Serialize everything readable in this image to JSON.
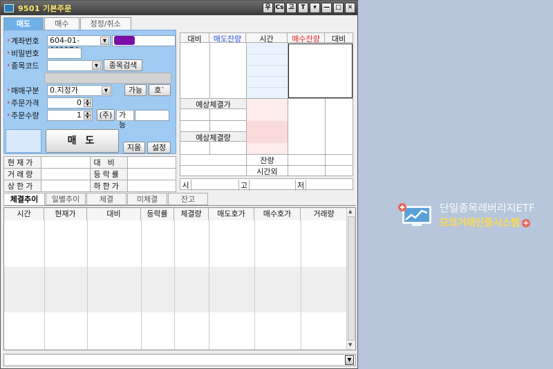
{
  "window": {
    "title": "9501 기본주문",
    "title_buttons": [
      "우",
      "Cs",
      "고",
      "T",
      "▾",
      "—",
      "□",
      "✕"
    ]
  },
  "order_tabs": [
    "매도",
    "매수",
    "정정/취소"
  ],
  "form": {
    "account_label": "계좌번호",
    "account_value": "604-01-001174",
    "password_label": "비밀번호",
    "code_label": "종목코드",
    "search_button": "종목검색",
    "type_label": "매매구분",
    "type_value": "0.지정가",
    "avail_button": "가능",
    "quote_button": "호`",
    "price_label": "주문가격",
    "price_value": "0",
    "qty_label": "주문수량",
    "qty_value": "1",
    "unit_button": "(주)",
    "qty_avail_label": "가능",
    "sell_button": "매 도",
    "clear_button": "지움",
    "settings_button": "설정"
  },
  "info_table": {
    "current_price": "현재가",
    "change": "대비",
    "volume": "거래량",
    "change_rate": "등락률",
    "upper_limit": "상한가",
    "lower_limit": "하한가"
  },
  "hoga": {
    "headers": [
      "대비",
      "매도잔량",
      "시간",
      "매수잔량",
      "대비"
    ],
    "expected_price": "예상체결가",
    "expected_volume": "예상체결량",
    "remain": "잔량",
    "after_hours": "시간외",
    "open": "시",
    "high": "고",
    "low": "저"
  },
  "bottom_tabs": [
    "체결추이",
    "일별추이",
    "체결",
    "미체결",
    "잔고"
  ],
  "grid_headers": [
    "시간",
    "현재가",
    "대비",
    "등락률",
    "체결량",
    "매도호가",
    "매수호가",
    "거래량"
  ],
  "brand": {
    "line1": "단일종목레버리지ETF",
    "line2": "모의거래인증시스템"
  },
  "colors": {
    "title_text": "#ffe567",
    "panel_blue": "#9fcbf3",
    "active_tab": "#6fb0e8",
    "sell_red": "#e03030",
    "desktop": "#b7c6da",
    "brand_yellow": "#ffd94f"
  }
}
